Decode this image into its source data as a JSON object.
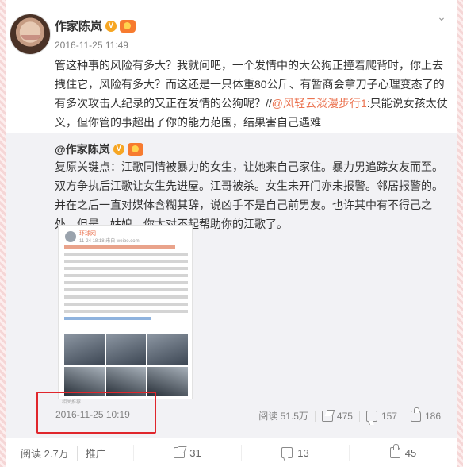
{
  "post": {
    "author": "作家陈岚",
    "time": "2016-11-25 11:49",
    "text_before_link": "管这种事的风险有多大？我就问吧，一个发情中的大公狗正撞着爬背时，你上去拽住它，风险有多大？而这还是一只体重80公斤、有暂商会拿刀子心理变态了的有多次攻击人纪录的又正在发情的公狗呢？//",
    "link_text": "@风轻云淡漫步行1",
    "text_after_link": ":只能说女孩太仗义，但你管的事超出了你的能力范围，结果害自己遇难"
  },
  "quoted": {
    "author": "@作家陈岚",
    "text": "复原关键点：江歌同情被暴力的女生，让她来自己家住。暴力男追踪女友而至。双方争执后江歌让女生先进屋。江哥被杀。女生未开门亦未报警。邻居报警的。并在之后一直对媒体含糊其辞，说凶手不是自己前男友。也许其中有不得己之处，但是，姑娘，你太对不起帮助你的江歌了。",
    "time": "2016-11-25 10:19",
    "image": {
      "name": "环球网",
      "meta": "11-24 18:18 来自 weibo.com",
      "footer_tag": "相关推荐"
    },
    "stats": {
      "reads": "阅读 51.5万",
      "shares": "475",
      "comments": "157",
      "likes": "186"
    }
  },
  "footer": {
    "reads": "阅读 2.7万",
    "promote": "推广",
    "shares": "31",
    "comments": "13",
    "likes": "45"
  },
  "icons": [
    "more-icon",
    "verified-icon",
    "fan-badge-icon",
    "share-icon",
    "comment-icon",
    "like-icon"
  ],
  "colors": {
    "link": "#eb7350",
    "highlight_box": "#e0262c",
    "verified": "#f6a623"
  }
}
